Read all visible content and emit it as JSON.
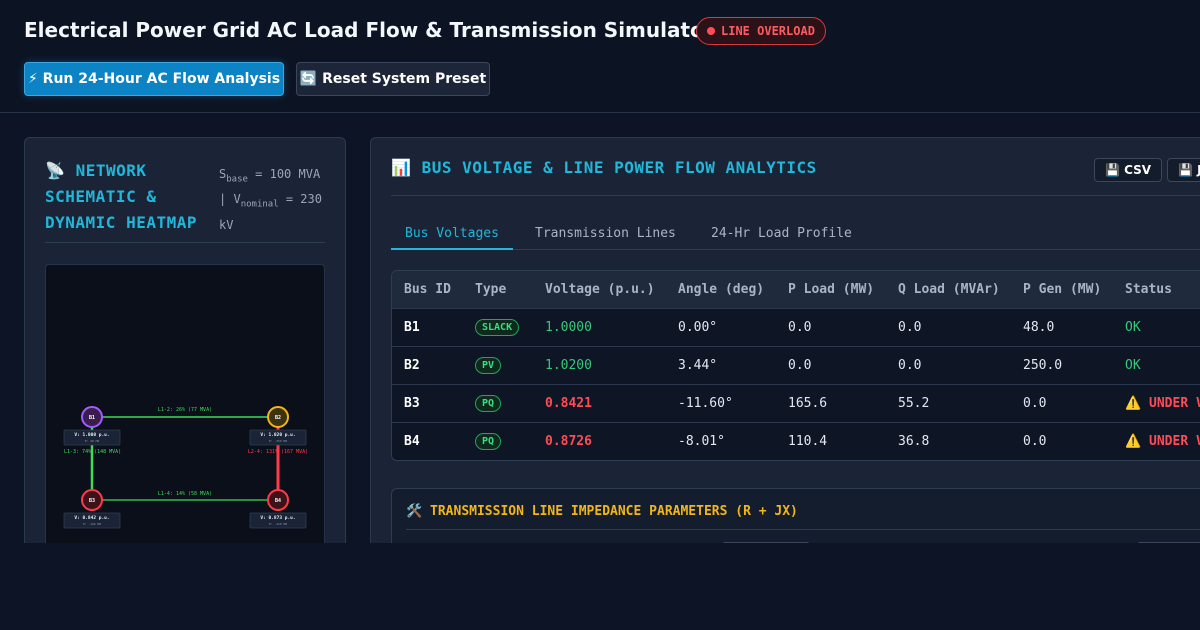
{
  "header": {
    "title": "Electrical Power Grid AC Load Flow & Transmission Simulator",
    "alert_badge": "LINE OVERLOAD",
    "run_button": "⚡ Run 24-Hour AC Flow Analysis",
    "reset_button": "🔄 Reset System Preset"
  },
  "network_panel": {
    "icon": "📡",
    "title": "NETWORK SCHEMATIC & DYNAMIC HEATMAP",
    "sbase_label": "S",
    "sbase_sub": "base",
    "sbase_value": " = 100 MVA",
    "vnom_sep": "| V",
    "vnom_sub": "nominal",
    "vnom_value": " = 230 kV",
    "buses": [
      {
        "id": "B1",
        "voltage_label": "V: 1.000 p.u.",
        "sub_label": "P: 48 MW"
      },
      {
        "id": "B2",
        "voltage_label": "V: 1.020 p.u.",
        "sub_label": "P: -250 MW"
      },
      {
        "id": "B3",
        "voltage_label": "V: 0.842 p.u.",
        "sub_label": "P: -166 MW"
      },
      {
        "id": "B4",
        "voltage_label": "V: 0.873 p.u.",
        "sub_label": "P: -110 MW"
      }
    ],
    "lines": [
      {
        "id": "L1-2",
        "label": "L1-2: 26% (77 MVA)",
        "color": "#3ddc5a"
      },
      {
        "id": "L1-3",
        "label": "L1-3: 74% (148 MVA)",
        "color": "#3ddc5a"
      },
      {
        "id": "L2-4",
        "label": "L2-4: 131% (167 MVA)",
        "color": "#ff3b4a"
      },
      {
        "id": "L1-4",
        "label": "L1-4: 14% (58 MVA)",
        "color": "#3ddc5a"
      }
    ]
  },
  "analytics_panel": {
    "icon": "📊",
    "title": "BUS VOLTAGE & LINE POWER FLOW ANALYTICS",
    "export_csv": "💾 CSV",
    "export_json": "💾 JSON",
    "tabs": [
      {
        "label": "Bus Voltages",
        "active": true
      },
      {
        "label": "Transmission Lines",
        "active": false
      },
      {
        "label": "24-Hr Load Profile",
        "active": false
      }
    ],
    "table": {
      "headers": [
        "Bus ID",
        "Type",
        "Voltage (p.u.)",
        "Angle (deg)",
        "P Load (MW)",
        "Q Load (MVAr)",
        "P Gen (MW)",
        "Status"
      ],
      "rows": [
        {
          "bus": "B1",
          "type": "SLACK",
          "voltage": "1.0000",
          "angle": "0.00°",
          "p_load": "0.0",
          "q_load": "0.0",
          "p_gen": "48.0",
          "status": "OK",
          "alarm": false
        },
        {
          "bus": "B2",
          "type": "PV",
          "voltage": "1.0200",
          "angle": "3.44°",
          "p_load": "0.0",
          "q_load": "0.0",
          "p_gen": "250.0",
          "status": "OK",
          "alarm": false
        },
        {
          "bus": "B3",
          "type": "PQ",
          "voltage": "0.8421",
          "angle": "-11.60°",
          "p_load": "165.6",
          "q_load": "55.2",
          "p_gen": "0.0",
          "status": "⚠️ UNDER VOLTAGE",
          "alarm": true
        },
        {
          "bus": "B4",
          "type": "PQ",
          "voltage": "0.8726",
          "angle": "-8.01°",
          "p_load": "110.4",
          "q_load": "36.8",
          "p_gen": "0.0",
          "status": "⚠️ UNDER VOLTAGE",
          "alarm": true
        }
      ]
    },
    "impedance": {
      "icon": "🛠️",
      "title": "TRANSMISSION LINE IMPEDANCE PARAMETERS (R + JX)"
    }
  },
  "colors": {
    "accent": "#22b6d9",
    "ok": "#34c97a",
    "alarm": "#ff4b55",
    "warning_title": "#f2b61b",
    "bus_b1": "#a15cff",
    "bus_b2": "#f2b61b",
    "bus_b3": "#ff3b4a",
    "bus_b4": "#ff3b4a"
  }
}
